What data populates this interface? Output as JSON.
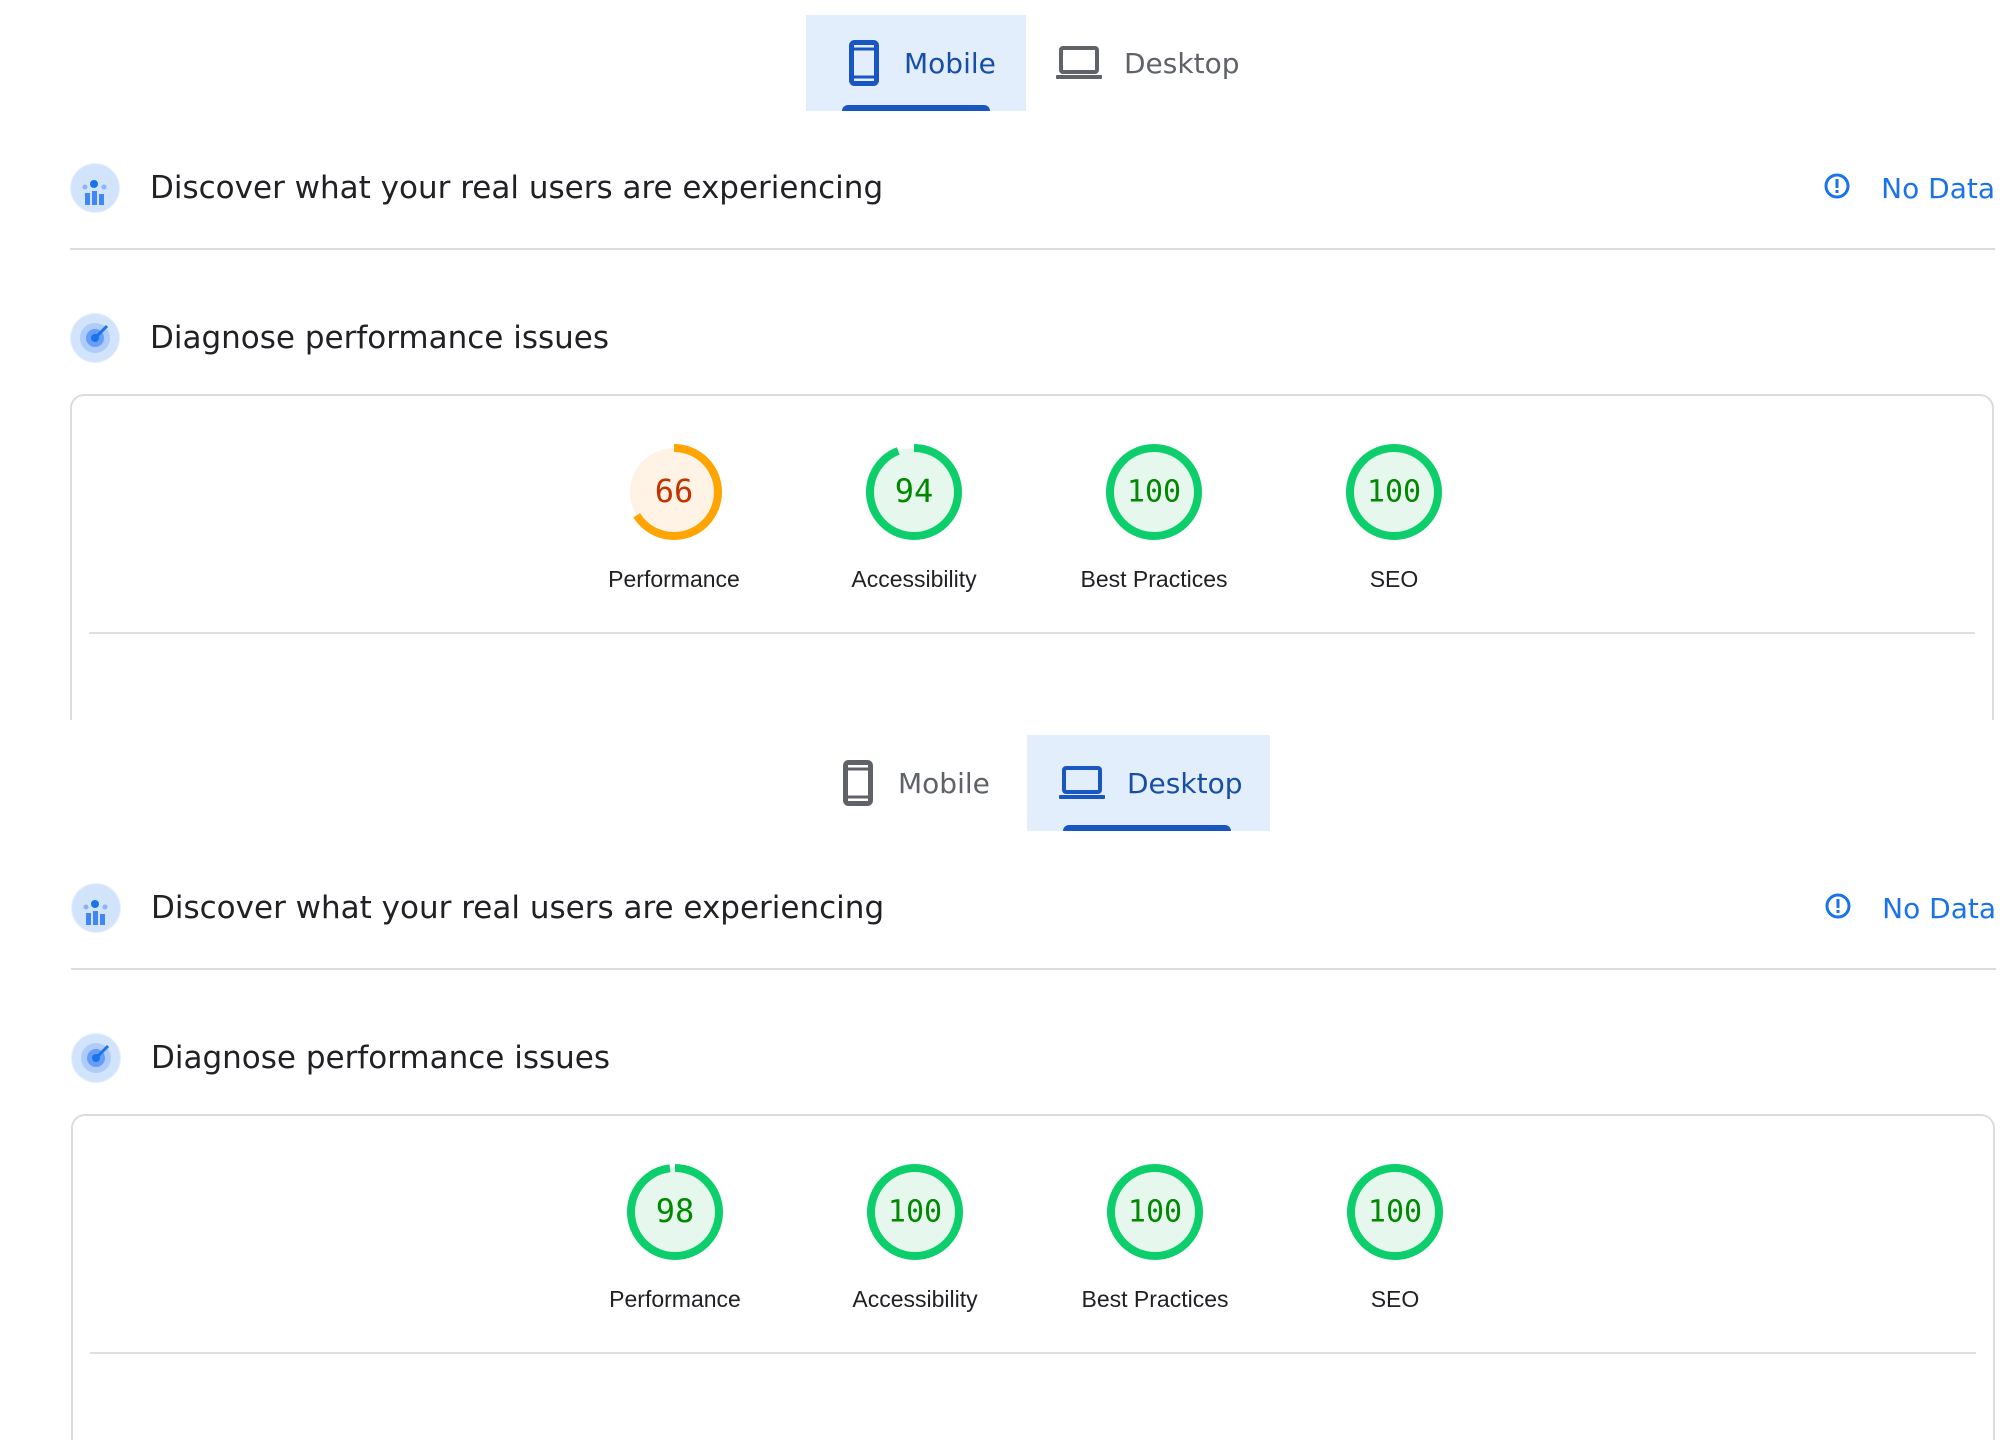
{
  "colors": {
    "accent_blue": "#1a73e8",
    "active_tab_bg": "#e2eefc",
    "pass_green": "#0cce6b",
    "pass_fill": "#e6f8ee",
    "pass_text": "#008800",
    "average_orange": "#ffa400",
    "average_fill": "#fff3e6",
    "average_text": "#c33300"
  },
  "panels": [
    {
      "tabs": [
        {
          "label": "Mobile",
          "icon": "smartphone-icon",
          "active": true
        },
        {
          "label": "Desktop",
          "icon": "laptop-icon",
          "active": false
        }
      ],
      "field_section": {
        "title": "Discover what your real users are experiencing",
        "status": "No Data",
        "status_icon": "info-icon"
      },
      "lab_section": {
        "title": "Diagnose performance issues"
      },
      "scores": [
        {
          "label": "Performance",
          "value": 66,
          "rating": "average"
        },
        {
          "label": "Accessibility",
          "value": 94,
          "rating": "pass"
        },
        {
          "label": "Best Practices",
          "value": 100,
          "rating": "pass"
        },
        {
          "label": "SEO",
          "value": 100,
          "rating": "pass"
        }
      ]
    },
    {
      "tabs": [
        {
          "label": "Mobile",
          "icon": "smartphone-icon",
          "active": false
        },
        {
          "label": "Desktop",
          "icon": "laptop-icon",
          "active": true
        }
      ],
      "field_section": {
        "title": "Discover what your real users are experiencing",
        "status": "No Data",
        "status_icon": "info-icon"
      },
      "lab_section": {
        "title": "Diagnose performance issues"
      },
      "scores": [
        {
          "label": "Performance",
          "value": 98,
          "rating": "pass"
        },
        {
          "label": "Accessibility",
          "value": 100,
          "rating": "pass"
        },
        {
          "label": "Best Practices",
          "value": 100,
          "rating": "pass"
        },
        {
          "label": "SEO",
          "value": 100,
          "rating": "pass"
        }
      ]
    }
  ]
}
